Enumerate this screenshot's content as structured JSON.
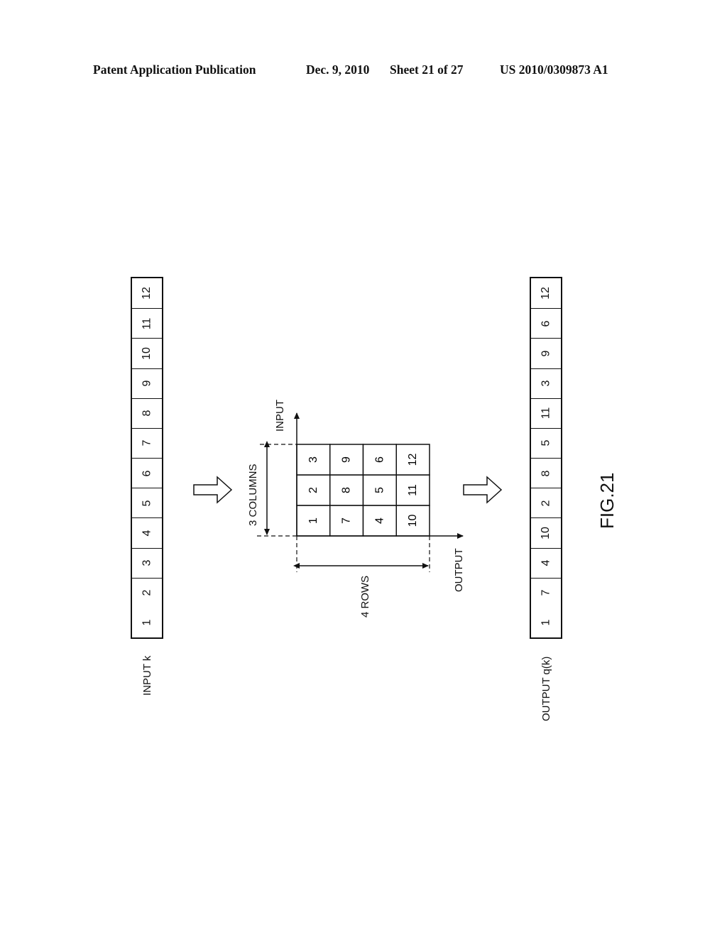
{
  "header": {
    "publication": "Patent Application Publication",
    "date": "Dec. 9, 2010",
    "sheet": "Sheet 21 of 27",
    "number": "US 2010/0309873 A1"
  },
  "input_strip": {
    "label": "INPUT k",
    "cells": [
      "1",
      "2",
      "3",
      "4",
      "5",
      "6",
      "7",
      "8",
      "9",
      "10",
      "11",
      "12"
    ]
  },
  "matrix": {
    "input_axis_label": "INPUT",
    "output_axis_label": "OUTPUT",
    "columns_label": "3 COLUMNS",
    "rows_label": "4 ROWS",
    "rows": [
      [
        "1",
        "2",
        "3"
      ],
      [
        "7",
        "8",
        "9"
      ],
      [
        "4",
        "5",
        "6"
      ],
      [
        "10",
        "11",
        "12"
      ]
    ]
  },
  "output_strip": {
    "label": "OUTPUT q(k)",
    "cells": [
      "1",
      "7",
      "4",
      "10",
      "2",
      "8",
      "5",
      "11",
      "3",
      "9",
      "6",
      "12"
    ]
  },
  "figure_label": "FIG.21",
  "icons": {
    "arrow_1": "hollow-right-arrow-icon",
    "arrow_2": "hollow-right-arrow-icon"
  }
}
